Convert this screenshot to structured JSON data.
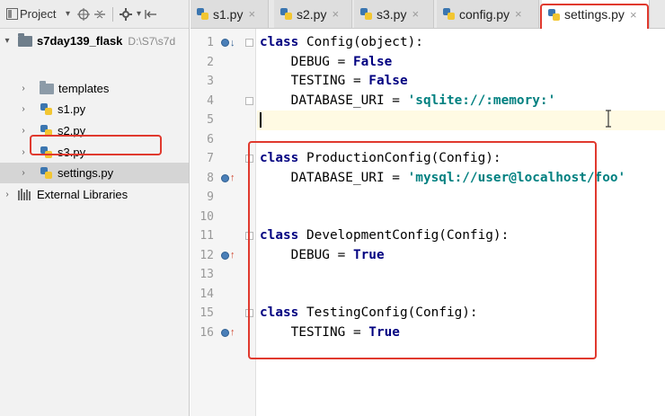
{
  "project_panel": {
    "title": "Project",
    "tree": [
      {
        "label": "s7day139_flask",
        "hint": "D:\\S7\\s7d",
        "type": "root-folder",
        "arrow": "▾"
      },
      {
        "label": "templates",
        "type": "folder",
        "arrow": "›"
      },
      {
        "label": "s1.py",
        "type": "py",
        "arrow": "›"
      },
      {
        "label": "s2.py",
        "type": "py",
        "arrow": "›"
      },
      {
        "label": "s3.py",
        "type": "py",
        "arrow": "›"
      },
      {
        "label": "settings.py",
        "type": "py",
        "arrow": "›",
        "selected": true
      },
      {
        "label": "External Libraries",
        "type": "lib",
        "arrow": "›"
      }
    ]
  },
  "tabs": [
    {
      "label": "s1.py",
      "close": "×"
    },
    {
      "label": "s2.py",
      "close": "×"
    },
    {
      "label": "s3.py",
      "close": "×"
    },
    {
      "label": "config.py",
      "close": "×"
    },
    {
      "label": "settings.py",
      "close": "×",
      "active": true
    }
  ],
  "editor": {
    "line_numbers": [
      "1",
      "2",
      "3",
      "4",
      "5",
      "6",
      "7",
      "8",
      "9",
      "10",
      "11",
      "12",
      "13",
      "14",
      "15",
      "16"
    ],
    "lines": [
      [
        {
          "t": "kw",
          "v": "class"
        },
        {
          "t": "n",
          "v": " Config(object):"
        }
      ],
      [
        {
          "t": "n",
          "v": "    DEBUG = "
        },
        {
          "t": "kw",
          "v": "False"
        }
      ],
      [
        {
          "t": "n",
          "v": "    TESTING = "
        },
        {
          "t": "kw",
          "v": "False"
        }
      ],
      [
        {
          "t": "n",
          "v": "    DATABASE_URI = "
        },
        {
          "t": "str",
          "v": "'sqlite://:memory:'"
        }
      ],
      [],
      [],
      [
        {
          "t": "kw",
          "v": "class"
        },
        {
          "t": "n",
          "v": " ProductionConfig(Config):"
        }
      ],
      [
        {
          "t": "n",
          "v": "    DATABASE_URI = "
        },
        {
          "t": "str",
          "v": "'mysql://user@localhost/foo'"
        }
      ],
      [],
      [],
      [
        {
          "t": "kw",
          "v": "class"
        },
        {
          "t": "n",
          "v": " DevelopmentConfig(Config):"
        }
      ],
      [
        {
          "t": "n",
          "v": "    DEBUG = "
        },
        {
          "t": "kw",
          "v": "True"
        }
      ],
      [],
      [],
      [
        {
          "t": "kw",
          "v": "class"
        },
        {
          "t": "n",
          "v": " TestingConfig(Config):"
        }
      ],
      [
        {
          "t": "n",
          "v": "    TESTING = "
        },
        {
          "t": "kw",
          "v": "True"
        }
      ]
    ],
    "current_line": 5,
    "markers": [
      {
        "line": 1,
        "arrow": "↓",
        "color": "#2f5f92"
      },
      {
        "line": 8,
        "arrow": "↑",
        "color": "#d0452e"
      },
      {
        "line": 12,
        "arrow": "↑",
        "color": "#d0452e"
      },
      {
        "line": 16,
        "arrow": "↑",
        "color": "#d0452e"
      }
    ],
    "folds": [
      1,
      4,
      7,
      11,
      15
    ]
  },
  "colors": {
    "annotation": "#e0392e",
    "keyword": "#000080",
    "string": "#008080"
  }
}
